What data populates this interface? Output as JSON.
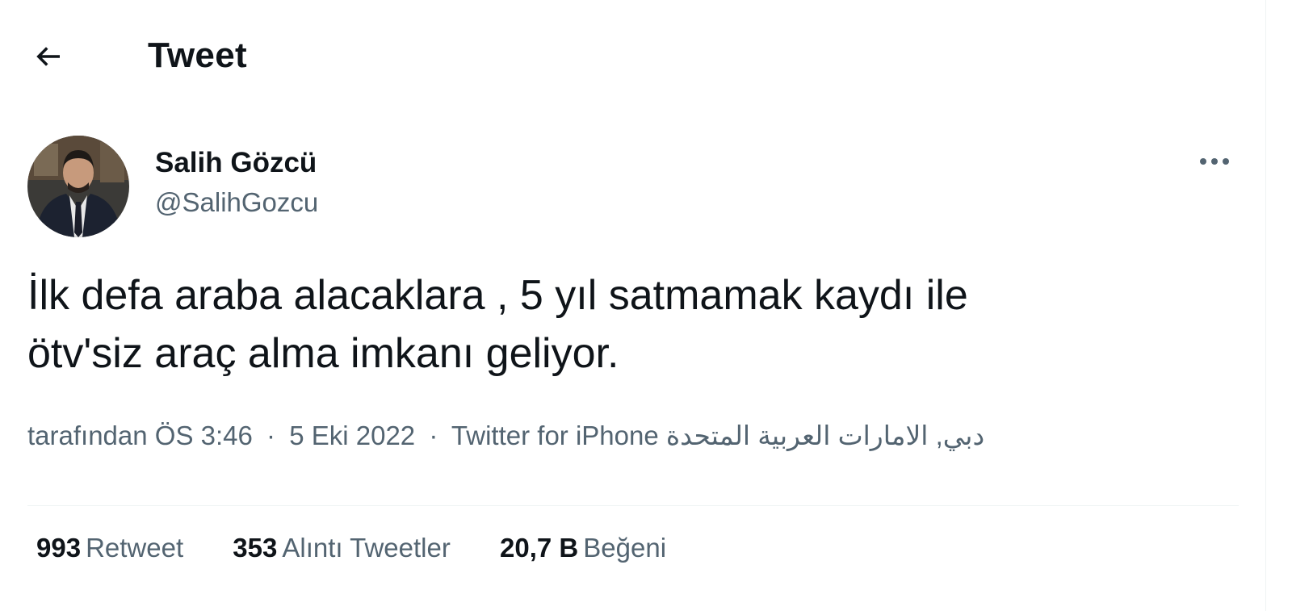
{
  "header": {
    "title": "Tweet",
    "back_icon": "arrow-left-icon"
  },
  "author": {
    "display_name": "Salih Gözcü",
    "handle": "@SalihGozcu",
    "more_icon": "more-horizontal-icon"
  },
  "tweet": {
    "text_line1": "İlk defa araba alacaklara , 5 yıl satmamak kaydı ile",
    "text_line2": "ötv'siz araç alma imkanı geliyor."
  },
  "meta": {
    "location": "tarafından",
    "time": "ÖS 3:46",
    "date": "5 Eki 2022",
    "source": "Twitter for iPhone",
    "place": "دبي, الامارات العربية المتحدة",
    "separator": "·"
  },
  "stats": [
    {
      "count": "993",
      "label": "Retweet"
    },
    {
      "count": "353",
      "label": "Alıntı Tweetler"
    },
    {
      "count": "20,7 B",
      "label": "Beğeni"
    }
  ],
  "colors": {
    "primary_text": "#0f1419",
    "secondary_text": "#536471",
    "divider": "#eff3f4"
  }
}
